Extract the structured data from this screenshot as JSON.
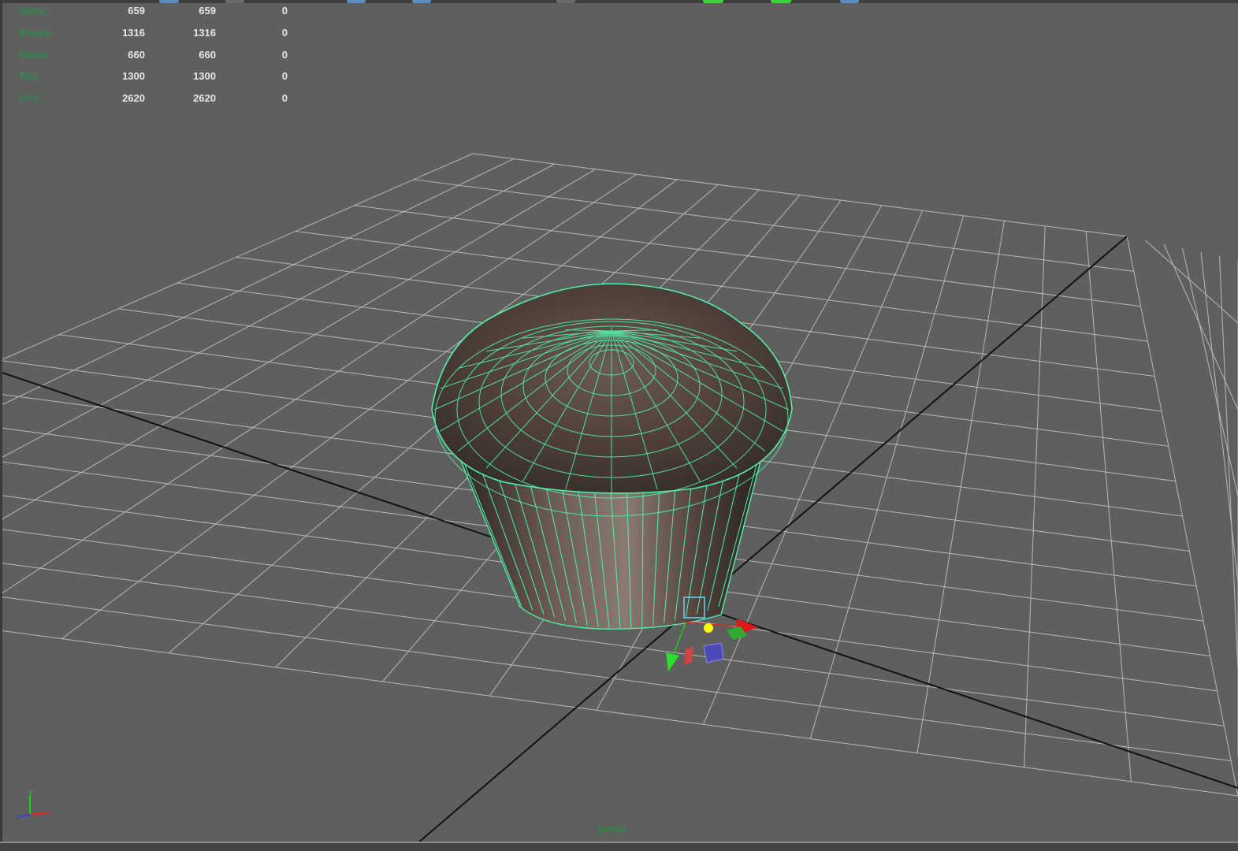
{
  "hud": {
    "rows": [
      {
        "label": "Verts:",
        "v1": "659",
        "v2": "659",
        "v3": "0"
      },
      {
        "label": "Edges:",
        "v1": "1316",
        "v2": "1316",
        "v3": "0"
      },
      {
        "label": "Faces:",
        "v1": "660",
        "v2": "660",
        "v3": "0"
      },
      {
        "label": "Tris:",
        "v1": "1300",
        "v2": "1300",
        "v3": "0"
      },
      {
        "label": "UVs:",
        "v1": "2620",
        "v2": "2620",
        "v3": "0"
      }
    ]
  },
  "viewport": {
    "camera_label": "persp",
    "background_color": "#5f5f5f",
    "grid_color": "#c8c8c8",
    "axis_line_color": "#111111",
    "wireframe_color": "#52f0a8",
    "hud_label_color": "#2f8a4a"
  },
  "axis_indicator": {
    "x": "x",
    "y": "y",
    "z": "z"
  },
  "model": {
    "icon": "cupcake-mesh",
    "gizmo": "move-manipulator-icon"
  }
}
